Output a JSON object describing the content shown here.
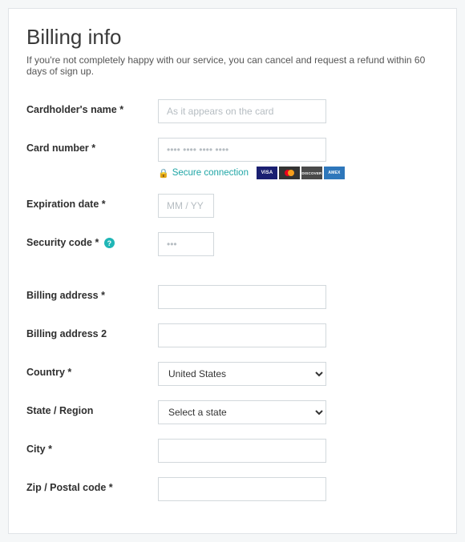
{
  "heading": "Billing info",
  "subhead": "If you're not completely happy with our service, you can cancel and request a refund within 60 days of sign up.",
  "labels": {
    "cardholder": "Cardholder's name *",
    "cardnumber": "Card number *",
    "expiration": "Expiration date *",
    "security": "Security code *",
    "addr1": "Billing address *",
    "addr2": "Billing address 2",
    "country": "Country *",
    "state": "State / Region",
    "city": "City *",
    "zip": "Zip / Postal code *"
  },
  "placeholders": {
    "cardholder": "As it appears on the card",
    "cardnumber": "•••• •••• •••• ••••",
    "expiration": "MM / YY",
    "security": "•••"
  },
  "secure_text": "Secure connection",
  "country_selected": "United States",
  "state_placeholder": "Select a state",
  "card_brands": {
    "visa": "VISA",
    "mc": "MC",
    "disc": "DISCOVER",
    "amex": "AMEX"
  }
}
